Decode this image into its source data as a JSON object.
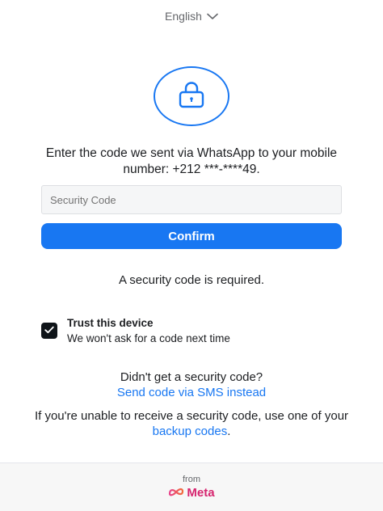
{
  "header": {
    "language": "English"
  },
  "prompt": {
    "instruction": "Enter the code we sent via WhatsApp to your mobile number: +212 ***-****49."
  },
  "form": {
    "code_placeholder": "Security Code",
    "code_value": "",
    "confirm_label": "Confirm",
    "error_message": "A security code is required."
  },
  "trust_device": {
    "checked": true,
    "title": "Trust this device",
    "subtitle": "We won't ask for a code next time"
  },
  "resend": {
    "question": "Didn't get a security code?",
    "link_label": "Send code via SMS instead"
  },
  "backup": {
    "text_before": "If you're unable to receive a security code, use one of your ",
    "link_label": "backup codes",
    "text_after": "."
  },
  "footer": {
    "from_label": "from",
    "brand": "Meta"
  },
  "colors": {
    "accent": "#1877f2",
    "meta_brand": "#d6246e"
  }
}
